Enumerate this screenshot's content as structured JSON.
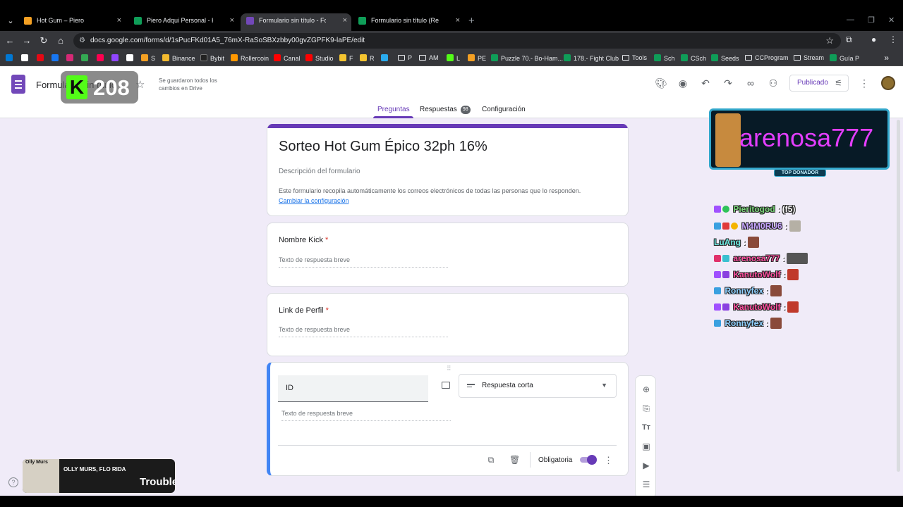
{
  "browser": {
    "tabs": [
      {
        "title": "Hot Gum – Piero",
        "icon_color": "#f4a023"
      },
      {
        "title": "Piero Adqui Personal - Hojas de...",
        "icon_color": "#0f9d58"
      },
      {
        "title": "Formulario sin título - Formular...",
        "icon_color": "#7248b9"
      },
      {
        "title": "Formulario sin título (Respuesta...",
        "icon_color": "#0f9d58"
      }
    ],
    "tab_close_glyph": "×",
    "new_tab_glyph": "+",
    "url": "docs.google.com/forms/d/1sPucFKd01A5_76mX-RaSoSBXzbby00gvZGPFK9-laPE/edit",
    "bookmarks": [
      "S",
      "Binance",
      "Bybit",
      "Rollercoin",
      "Canal",
      "Studio",
      "F",
      "R",
      "P",
      "AM",
      "L",
      "PE",
      "Puzzle 70.- Bo-Ham...",
      "178.- Fight Club",
      "Tools",
      "Sch",
      "CSch",
      "Seeds",
      "CCProgram",
      "Stream",
      "Guía P"
    ]
  },
  "header": {
    "doc_title": "Formulario sin título",
    "save_status": "Se guardaron todos los cambios en Drive",
    "publish_label": "Publicado",
    "kick_viewer_count": "208",
    "kick_logo_letter": "K"
  },
  "nav": {
    "preguntas": "Preguntas",
    "respuestas": "Respuestas",
    "response_count": "98",
    "configuracion": "Configuración"
  },
  "form": {
    "title": "Sorteo Hot Gum Épico 32ph 16%",
    "description": "Descripción del formulario",
    "notice": "Este formulario recopila automáticamente los correos electrónicos de todas las personas que lo responden.",
    "notice_link": "Cambiar la configuración",
    "questions": [
      {
        "title": "Nombre Kick",
        "required_mark": "*",
        "placeholder": "Texto de respuesta breve"
      },
      {
        "title": "Link de Perfil",
        "required_mark": "*",
        "placeholder": "Texto de respuesta breve"
      }
    ],
    "active_question": {
      "title": "ID",
      "type": "Respuesta corta",
      "placeholder": "Texto de respuesta breve",
      "required_label": "Obligatoria",
      "required_on": true
    }
  },
  "overlay": {
    "top_donor_name": "arenosa777",
    "top_donor_tag": "TOP DONADOR",
    "chat": [
      {
        "user": "Pieritogod",
        "sep": ":",
        "message": "(f5)",
        "color": "#7ad67a"
      },
      {
        "user": "M4M0RU6",
        "sep": ":",
        "message": "",
        "color": "#c7a6ff"
      },
      {
        "user": "LuAng",
        "sep": ":",
        "message": "",
        "color": "#6ee7e0"
      },
      {
        "user": "arenosa777",
        "sep": ":",
        "message": "",
        "color": "#ff4fa0"
      },
      {
        "user": "KanutoWolf",
        "sep": ":",
        "message": "",
        "color": "#ff4fa0"
      },
      {
        "user": "Ronnyfex",
        "sep": ":",
        "message": "",
        "color": "#8fd0ff"
      },
      {
        "user": "KanutoWolf",
        "sep": ":",
        "message": "",
        "color": "#ff4fa0"
      },
      {
        "user": "Ronnyfex",
        "sep": ":",
        "message": "",
        "color": "#8fd0ff"
      }
    ],
    "music_artist": "OLLY MURS, FLO RIDA",
    "music_title": "Trouble",
    "album_text": "Olly Murs"
  },
  "colors": {
    "accent": "#673ab7",
    "page_bg": "#f0ebf8",
    "active_border": "#4285f4",
    "required": "#d93025"
  }
}
